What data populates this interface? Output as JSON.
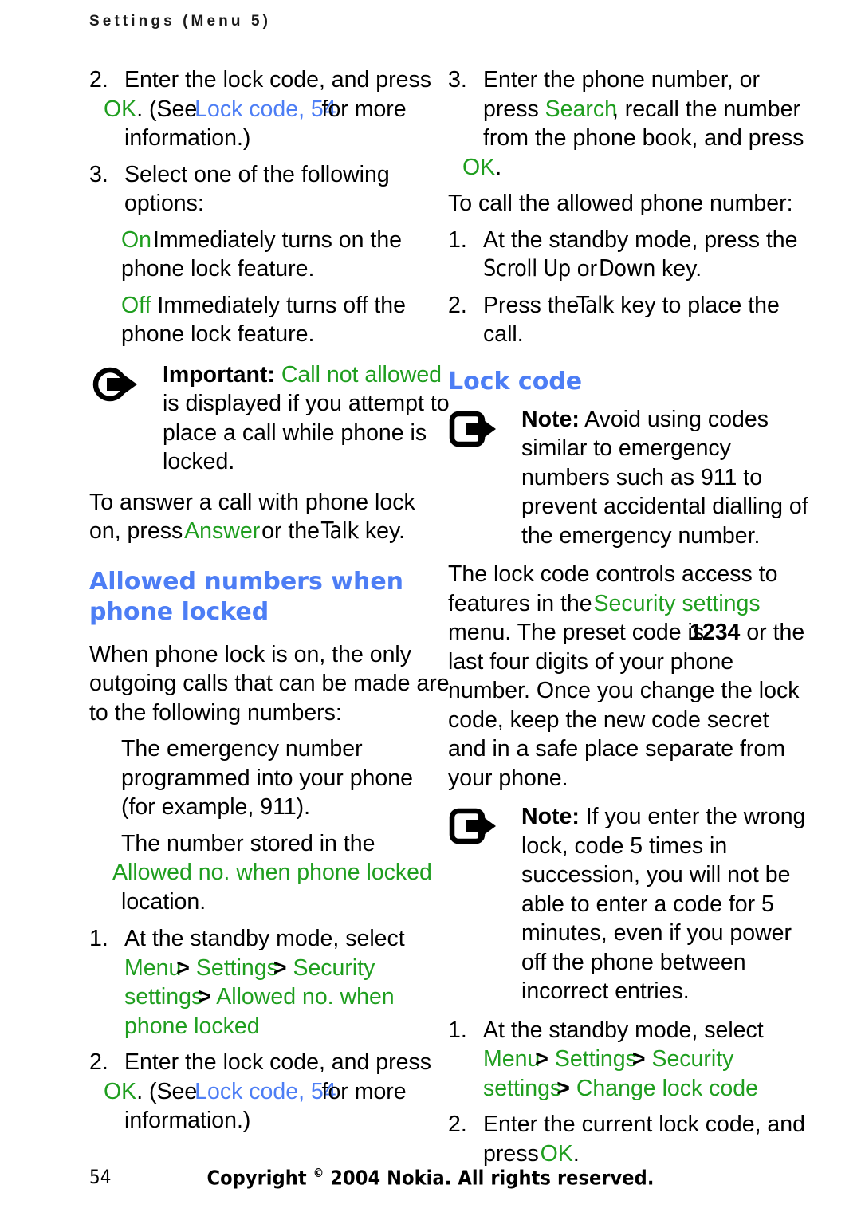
{
  "header": {
    "running_head": "Settings (Menu 5)"
  },
  "colors": {
    "ui_green": "#1f9e1f",
    "link_blue": "#4d7ef5",
    "heading_blue": "#4d7ef5",
    "body_black": "#000000"
  },
  "left_column": {
    "step2": {
      "num": "2.",
      "text_a": "Enter the lock code, and press ",
      "key_ok": "OK",
      "period": ".",
      "text_b": "(See ",
      "link": "Lock code, 54",
      "text_c": " for more information.)"
    },
    "step3": {
      "num": "3.",
      "text": "Select one of the following options:"
    },
    "option_on": {
      "key": "On",
      "text": " Immediately turns on the phone lock feature."
    },
    "option_off": {
      "key": "Off",
      "text": " Immediately turns off the phone lock feature."
    },
    "important_callout": {
      "icon": "important-arrow-icon",
      "label": "Important:",
      "ui_text": "Call not allowed",
      "text": " is displayed if you attempt to place a call while phone is locked."
    },
    "answer_para": {
      "text_a": "To answer a call with phone lock on, press ",
      "key_answer": "Answer",
      "text_b": " or the ",
      "key_talk": "Talk",
      "text_c": " key."
    },
    "heading_allowed": "Allowed numbers when phone locked",
    "intro_para": "When phone lock is on, the only outgoing calls that can be made are to the following numbers:",
    "bullet_emergency": "The emergency number programmed into your phone (for example, 911).",
    "bullet_stored": {
      "text_a": "The number stored in the ",
      "ui_text": "Allowed no. when phone locked",
      "text_b": " location."
    },
    "step1_allowed": {
      "num": "1.",
      "text": "At the standby mode, select ",
      "path": [
        "Menu",
        "Settings",
        "Security settings",
        "Allowed no. when phone locked"
      ],
      "separator": ">"
    },
    "step2_allowed": {
      "num": "2.",
      "text_a": "Enter the lock code, and press ",
      "key_ok": "OK",
      "period": ".",
      "text_b": "(See ",
      "link": "Lock code, 54",
      "text_c": " for more information.)"
    }
  },
  "right_column": {
    "step3": {
      "num": "3.",
      "text_a": "Enter the phone number, or press ",
      "key_search": "Search",
      "text_b": ", recall the number from the phone book, and press ",
      "key_ok": "OK",
      "period": "."
    },
    "to_call_para": "To call the allowed phone number:",
    "call_step1": {
      "num": "1.",
      "text_a": "At the standby mode, press the ",
      "key_scroll_up": "Scroll Up",
      "text_b": " or ",
      "key_down": "Down",
      "text_c": " key."
    },
    "call_step2": {
      "num": "2.",
      "text_a": "Press the ",
      "key_talk": "Talk",
      "text_b": " key to place the call."
    },
    "heading_lock_code": "Lock code",
    "note_emergency": {
      "icon": "note-arrow-icon",
      "label": "Note:",
      "text": " Avoid using codes similar to emergency numbers such as 911 to prevent accidental dialling of the emergency number."
    },
    "lock_code_para": {
      "text_a": "The lock code controls access to features in the ",
      "ui_text": "Security settings",
      "text_b": " menu. The preset code is ",
      "code": "1234",
      "text_c": " or the last four digits of your phone number. Once you change the lock code, keep the new code secret and in a safe place separate from your phone."
    },
    "note_wrong": {
      "icon": "note-arrow-icon",
      "label": "Note:",
      "text": " If you enter the wrong lock, code 5 times in succession, you will not be able to enter a code for 5 minutes, even if you power off the phone between incorrect entries."
    },
    "change_step1": {
      "num": "1.",
      "text": "At the standby mode, select ",
      "path": [
        "Menu",
        "Settings",
        "Security settings",
        "Change lock code"
      ],
      "separator": ">"
    },
    "change_step2": {
      "num": "2.",
      "text_a": "Enter the current lock code, and press ",
      "key_ok": "OK",
      "period": "."
    }
  },
  "footer": {
    "page_number": "54",
    "copyright_prefix": "Copyright ",
    "copyright_symbol": "©",
    "copyright_suffix": " 2004 Nokia. All rights reserved."
  }
}
